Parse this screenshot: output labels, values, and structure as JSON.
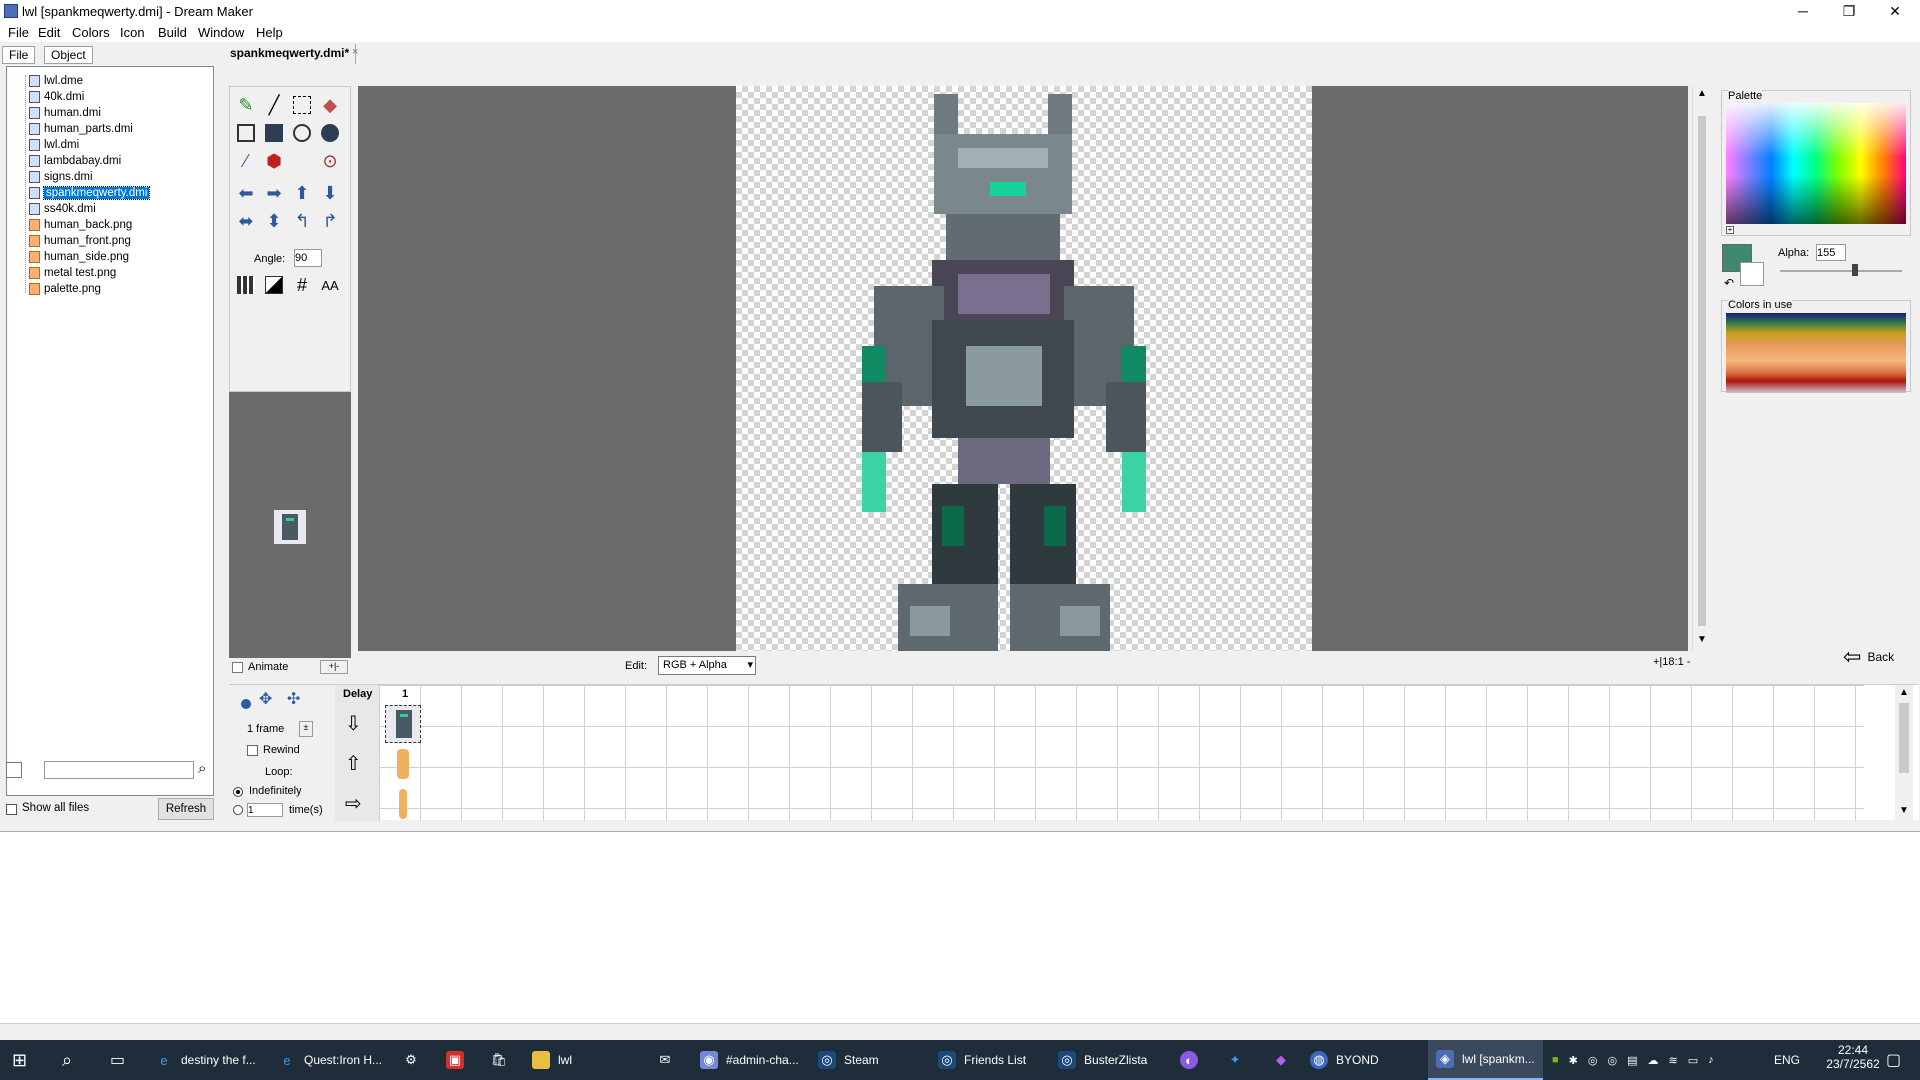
{
  "window": {
    "title": "lwl [spankmeqwerty.dmi] - Dream Maker",
    "minimize": "─",
    "maximize": "❐",
    "close": "✕"
  },
  "menu": [
    "File",
    "Edit",
    "Colors",
    "Icon",
    "Build",
    "Window",
    "Help"
  ],
  "left_tabs": [
    "File",
    "Object"
  ],
  "files": [
    {
      "name": "lwl.dme",
      "type": "dme"
    },
    {
      "name": "40k.dmi",
      "type": "dmi"
    },
    {
      "name": "human.dmi",
      "type": "dmi"
    },
    {
      "name": "human_parts.dmi",
      "type": "dmi"
    },
    {
      "name": "lwl.dmi",
      "type": "dmi"
    },
    {
      "name": "lambdabay.dmi",
      "type": "dmi"
    },
    {
      "name": "signs.dmi",
      "type": "dmi"
    },
    {
      "name": "spankmeqwerty.dmi",
      "type": "dmi",
      "selected": true
    },
    {
      "name": "ss40k.dmi",
      "type": "dmi"
    },
    {
      "name": "human_back.png",
      "type": "png"
    },
    {
      "name": "human_front.png",
      "type": "png"
    },
    {
      "name": "human_side.png",
      "type": "png"
    },
    {
      "name": "metal test.png",
      "type": "png"
    },
    {
      "name": "palette.png",
      "type": "png"
    }
  ],
  "left_bottom": {
    "search_value": "",
    "show_all_files": "Show all files",
    "refresh": "Refresh"
  },
  "editor_tab": "spankmeqwerty.dmi*",
  "tools": {
    "angle_label": "Angle:",
    "angle_value": "90",
    "aa_label": "AA"
  },
  "animate": {
    "label": "Animate"
  },
  "edit_mode": {
    "label": "Edit:",
    "value": "RGB + Alpha"
  },
  "zoom": "18:1",
  "palette": {
    "title": "Palette",
    "alpha_label": "Alpha:",
    "alpha_value": "155",
    "colors_in_use": "Colors in use",
    "current_color": "#3f8a6e"
  },
  "back_button": "Back",
  "timeline": {
    "dir_header": "Delay",
    "frame_header": "1",
    "frames_value": "1 frame",
    "rewind": "Rewind",
    "loop": "Loop:",
    "indefinitely": "Indefinitely",
    "times_value": "1",
    "times_label": "time(s)"
  },
  "taskbar": {
    "items": [
      {
        "label": "destiny the f...",
        "icon": "edge-icon"
      },
      {
        "label": "Quest:Iron H...",
        "icon": "edge-icon"
      },
      {
        "label": "",
        "icon": "settings-icon"
      },
      {
        "label": "",
        "icon": "gift-icon"
      },
      {
        "label": "",
        "icon": "store-icon"
      },
      {
        "label": "lwl",
        "icon": "folder-icon"
      },
      {
        "label": "",
        "icon": "mail-icon"
      },
      {
        "label": "#admin-cha...",
        "icon": "discord-icon"
      },
      {
        "label": "Steam",
        "icon": "steam-icon"
      },
      {
        "label": "Friends List",
        "icon": "steam-icon"
      },
      {
        "label": "BusterZlista",
        "icon": "steam-icon"
      },
      {
        "label": "BYOND",
        "icon": "byond-icon"
      },
      {
        "label": "lwl [spankm...",
        "icon": "dreammaker-icon"
      }
    ],
    "lang": "ENG",
    "time": "22:44",
    "date": "23/7/2562"
  }
}
